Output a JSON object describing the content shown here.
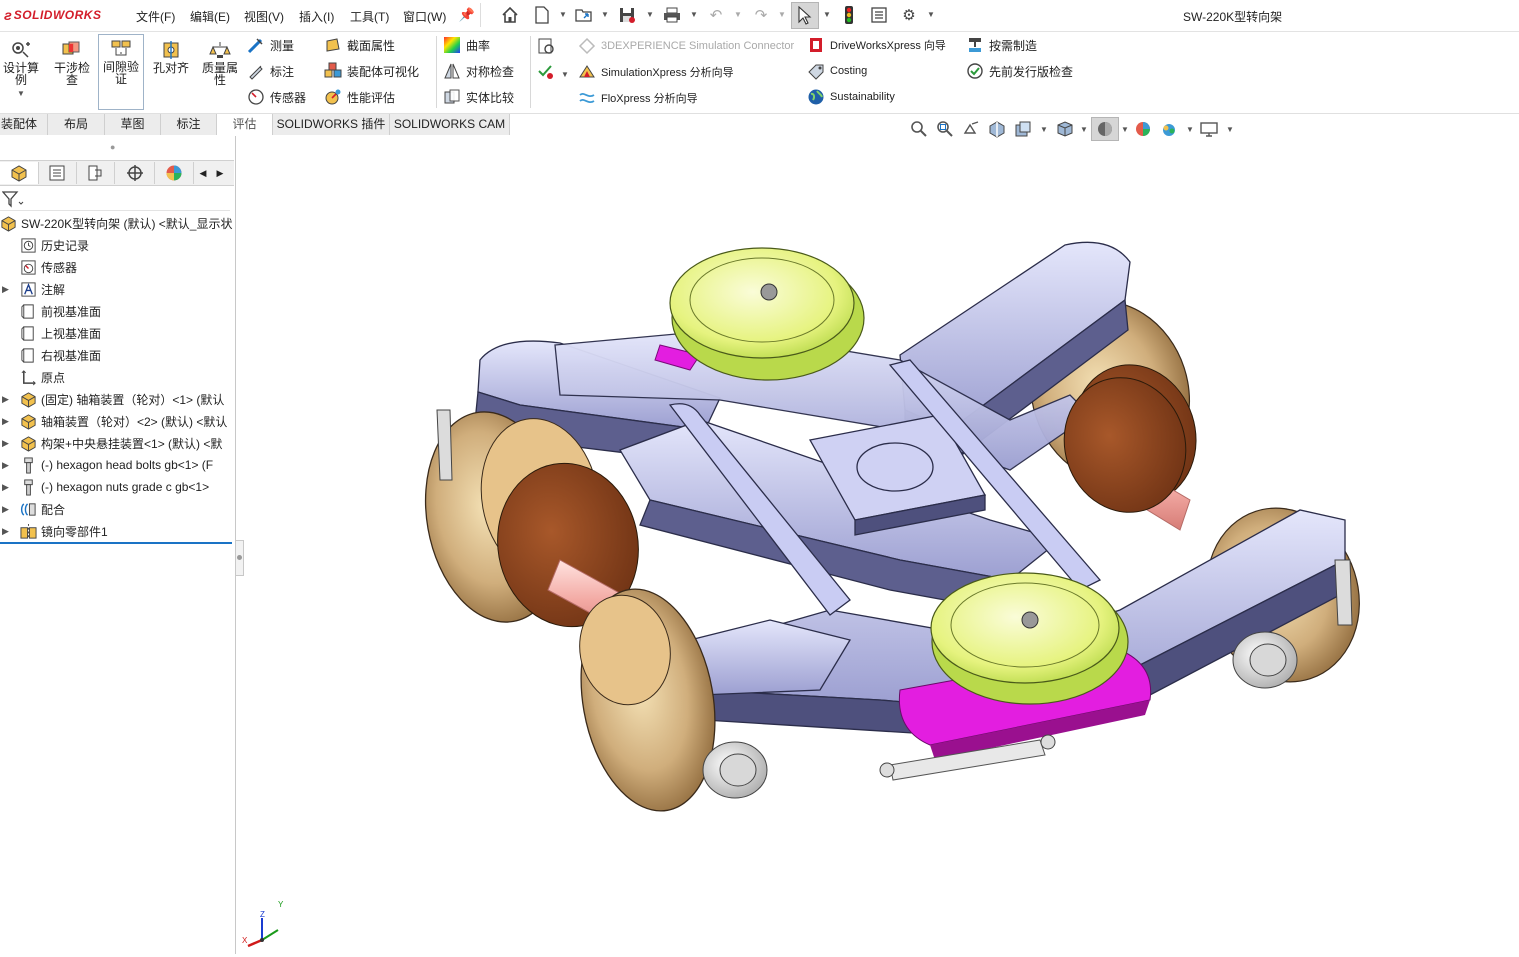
{
  "app": {
    "logo_text": "SOLIDWORKS",
    "doc_title": "SW-220K型转向架"
  },
  "menu": [
    {
      "label": "文件(F)"
    },
    {
      "label": "编辑(E)"
    },
    {
      "label": "视图(V)"
    },
    {
      "label": "插入(I)"
    },
    {
      "label": "工具(T)"
    },
    {
      "label": "窗口(W)"
    }
  ],
  "ribbon": {
    "big_buttons": [
      {
        "label": "设计算例"
      },
      {
        "label": "干涉检查"
      },
      {
        "label": "间隙验证"
      },
      {
        "label": "孔对齐"
      },
      {
        "label": "质量属性"
      }
    ],
    "col1": [
      {
        "label": "测量"
      },
      {
        "label": "标注"
      },
      {
        "label": "传感器"
      }
    ],
    "col2": [
      {
        "label": "截面属性"
      },
      {
        "label": "装配体可视化"
      },
      {
        "label": "性能评估"
      }
    ],
    "col3": [
      {
        "label": "曲率"
      },
      {
        "label": "对称检查"
      },
      {
        "label": "实体比较"
      }
    ],
    "col4": [
      {
        "label": "3DEXPERIENCE Simulation Connector"
      },
      {
        "label": "SimulationXpress 分析向导"
      },
      {
        "label": "FloXpress 分析向导"
      }
    ],
    "col5": [
      {
        "label": "DriveWorksXpress 向导"
      },
      {
        "label": "Costing"
      },
      {
        "label": "Sustainability"
      }
    ],
    "col6": [
      {
        "label": "按需制造"
      },
      {
        "label": "先前发行版检查"
      }
    ]
  },
  "tabs": [
    {
      "label": "装配体"
    },
    {
      "label": "布局"
    },
    {
      "label": "草图"
    },
    {
      "label": "标注"
    },
    {
      "label": "评估"
    },
    {
      "label": "SOLIDWORKS 插件"
    },
    {
      "label": "SOLIDWORKS CAM"
    }
  ],
  "tree": {
    "root": "SW-220K型转向架 (默认) <默认_显示状",
    "items": [
      {
        "label": "历史记录",
        "icon": "history-icon",
        "expand": false
      },
      {
        "label": "传感器",
        "icon": "sensor-icon",
        "expand": false
      },
      {
        "label": "注解",
        "icon": "annotation-icon",
        "expand": true
      },
      {
        "label": "前视基准面",
        "icon": "plane-icon",
        "expand": false
      },
      {
        "label": "上视基准面",
        "icon": "plane-icon",
        "expand": false
      },
      {
        "label": "右视基准面",
        "icon": "plane-icon",
        "expand": false
      },
      {
        "label": "原点",
        "icon": "origin-icon",
        "expand": false
      },
      {
        "label": "(固定) 轴箱装置（轮对）<1> (默认",
        "icon": "subassembly-icon",
        "expand": true
      },
      {
        "label": "轴箱装置（轮对）<2> (默认) <默认",
        "icon": "subassembly-icon",
        "expand": true
      },
      {
        "label": "构架+中央悬挂装置<1> (默认) <默",
        "icon": "subassembly-icon",
        "expand": true
      },
      {
        "label": "(-) hexagon head bolts gb<1> (F",
        "icon": "bolt-icon",
        "expand": true
      },
      {
        "label": "(-) hexagon nuts grade c gb<1>",
        "icon": "bolt-icon",
        "expand": true
      },
      {
        "label": "配合",
        "icon": "mates-icon",
        "expand": true
      },
      {
        "label": "镜向零部件1",
        "icon": "mirror-component-icon",
        "expand": true
      }
    ]
  },
  "triad": {
    "x": "X",
    "y": "Y",
    "z": "Z"
  },
  "colors": {
    "accent": "#1a73c5",
    "frame": "#a9acd8",
    "frame_dark": "#5a5c86",
    "wheel": "#c9a878",
    "wheel_hub": "#8a4420",
    "axle": "#f2b6b2",
    "spring_top": "#e9f59a",
    "damper": "#e31ee0"
  }
}
